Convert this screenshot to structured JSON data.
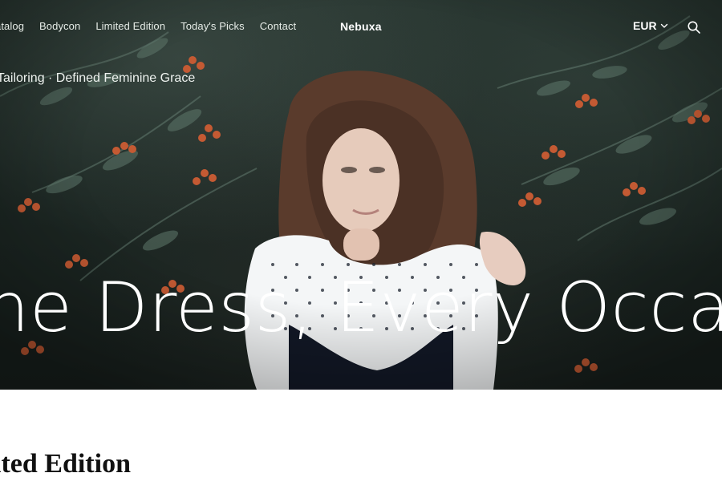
{
  "header": {
    "nav_links": [
      "atalog",
      "Bodycon",
      "Limited Edition",
      "Today's Picks",
      "Contact"
    ],
    "brand": "Nebuxa",
    "currency": "EUR",
    "icons": {
      "currency_dropdown": "chevron-down-icon",
      "search": "search-icon"
    }
  },
  "hero": {
    "tagline": "Tailoring · Defined Feminine Grace",
    "headline": "ne Dress, Every Occasio",
    "image": "woman-with-curly-hair-in-polka-dot-top-against-foliage-with-red-berries"
  },
  "section": {
    "title": "ited Edition"
  }
}
